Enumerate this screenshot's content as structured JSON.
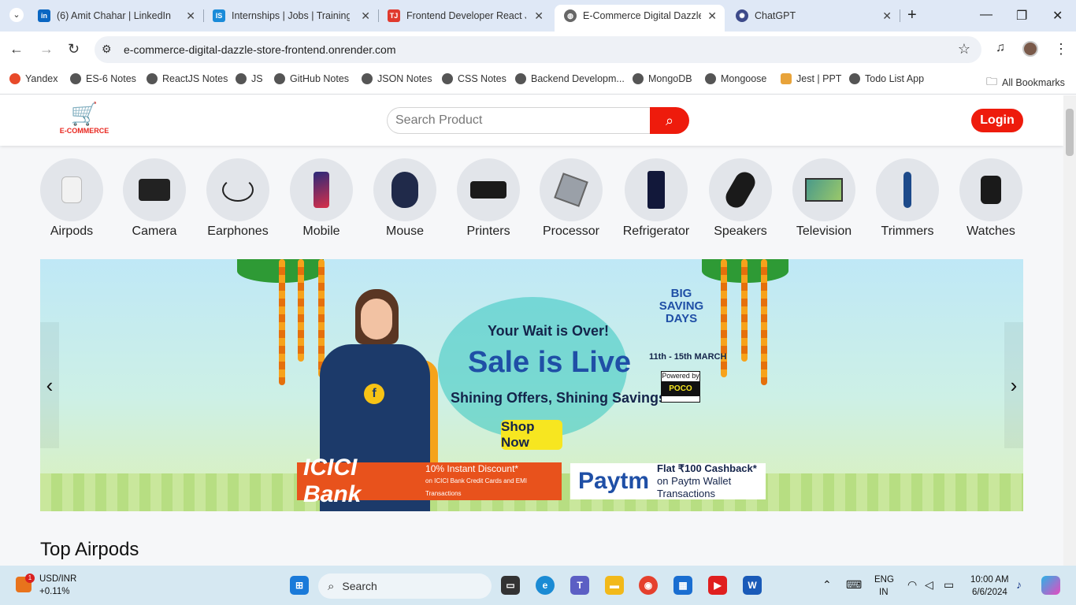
{
  "browser": {
    "tabs": [
      {
        "title": "(6) Amit Chahar | LinkedIn",
        "favicon": "in",
        "color": "#0a66c2"
      },
      {
        "title": "Internships | Jobs | Trainings",
        "favicon": "IS",
        "color": "#1a8bd9"
      },
      {
        "title": "Frontend Developer React JS",
        "favicon": "TJ",
        "color": "#e03a2e"
      },
      {
        "title": "E-Commerce Digital Dazzle S",
        "favicon": "globe",
        "color": "#555555"
      },
      {
        "title": "ChatGPT",
        "favicon": "gpt",
        "color": "#3d4a8a"
      }
    ],
    "url": "e-commerce-digital-dazzle-store-frontend.onrender.com",
    "bookmarks": [
      "Yandex",
      "ES-6 Notes",
      "ReactJS Notes",
      "JS",
      "GitHub Notes",
      "JSON Notes",
      "CSS Notes",
      "Backend Developm...",
      "MongoDB",
      "Mongoose",
      "Jest | PPT",
      "Todo List App"
    ],
    "all_bookmarks_label": "All Bookmarks"
  },
  "site": {
    "logo_text": "E-COMMERCE",
    "search_placeholder": "Search Product",
    "login_label": "Login",
    "categories": [
      "Airpods",
      "Camera",
      "Earphones",
      "Mobile",
      "Mouse",
      "Printers",
      "Processor",
      "Refrigerator",
      "Speakers",
      "Television",
      "Trimmers",
      "Watches"
    ],
    "banner": {
      "headline_small": "Your Wait is Over!",
      "headline": "Sale is Live",
      "subline": "Shining Offers, Shining Savings!",
      "cta": "Shop Now",
      "event_line1": "BIG",
      "event_line2": "SAVING",
      "event_line3": "DAYS",
      "dates": "11th - 15th MARCH",
      "powered_by": "Powered by",
      "powered_brand": "POCO",
      "bank_name": "ICICI Bank",
      "bank_offer_line1": "10% Instant Discount*",
      "bank_offer_line2": "on ICICI Bank Credit Cards and EMI Transactions",
      "wallet_name": "Paytm",
      "wallet_offer_line1": "Flat ₹100 Cashback*",
      "wallet_offer_line2": "on Paytm Wallet Transactions"
    },
    "section_title": "Top Airpods"
  },
  "taskbar": {
    "stock_name": "USD/INR",
    "stock_change": "+0.11%",
    "stock_badge": "1",
    "search_label": "Search",
    "lang_line1": "ENG",
    "lang_line2": "IN",
    "time": "10:00 AM",
    "date": "6/6/2024"
  }
}
